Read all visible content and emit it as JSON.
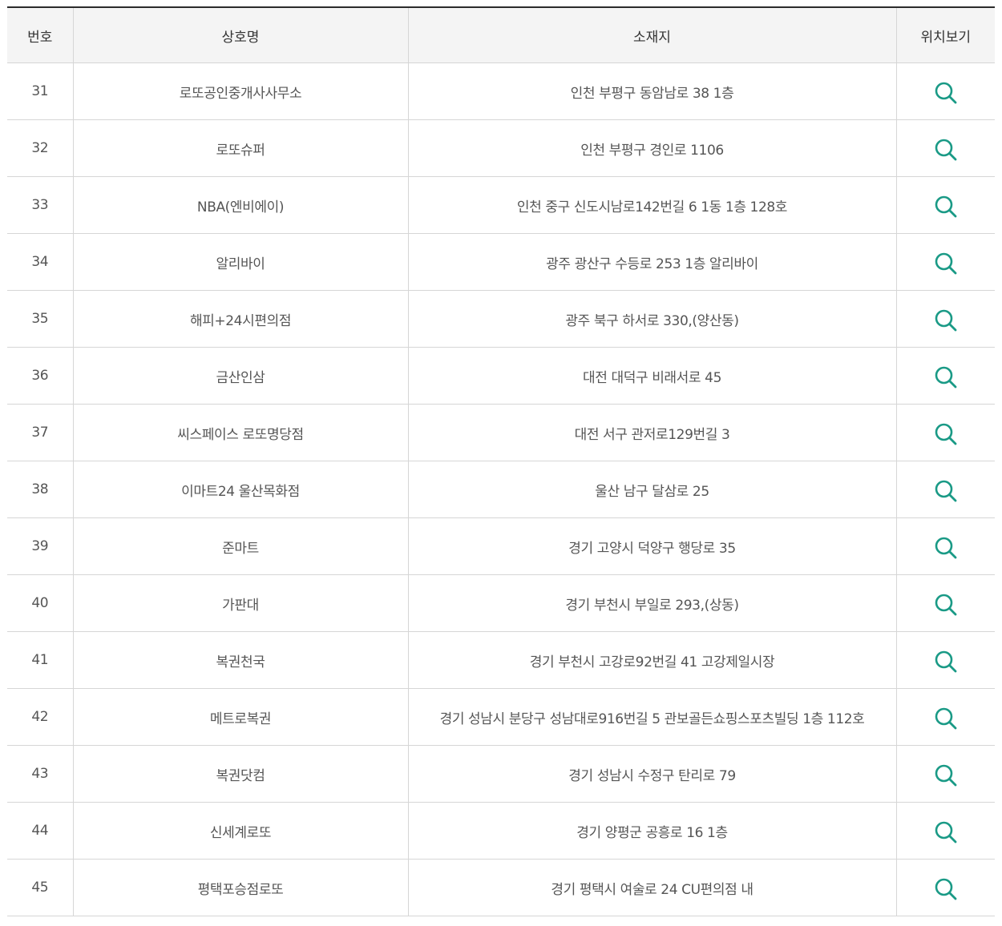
{
  "table": {
    "headers": {
      "no": "번호",
      "name": "상호명",
      "address": "소재지",
      "map": "위치보기"
    },
    "rows": [
      {
        "no": "31",
        "name": "로또공인중개사사무소",
        "address": "인천 부평구 동암남로 38 1층"
      },
      {
        "no": "32",
        "name": "로또슈퍼",
        "address": "인천 부평구 경인로 1106"
      },
      {
        "no": "33",
        "name": "NBA(엔비에이)",
        "address": "인천 중구 신도시남로142번길 6 1동 1층 128호"
      },
      {
        "no": "34",
        "name": "알리바이",
        "address": "광주 광산구 수등로 253 1층 알리바이"
      },
      {
        "no": "35",
        "name": "해피+24시편의점",
        "address": "광주 북구 하서로 330,(양산동)"
      },
      {
        "no": "36",
        "name": "금산인삼",
        "address": "대전 대덕구 비래서로 45"
      },
      {
        "no": "37",
        "name": "씨스페이스 로또명당점",
        "address": "대전 서구 관저로129번길 3"
      },
      {
        "no": "38",
        "name": "이마트24 울산목화점",
        "address": "울산 남구 달삼로 25"
      },
      {
        "no": "39",
        "name": "준마트",
        "address": "경기 고양시 덕양구 행당로 35"
      },
      {
        "no": "40",
        "name": "가판대",
        "address": "경기 부천시 부일로 293,(상동)"
      },
      {
        "no": "41",
        "name": "복권천국",
        "address": "경기 부천시 고강로92번길 41 고강제일시장"
      },
      {
        "no": "42",
        "name": "메트로복권",
        "address": "경기 성남시 분당구 성남대로916번길 5 관보골든쇼핑스포츠빌딩 1층 112호"
      },
      {
        "no": "43",
        "name": "복권닷컴",
        "address": "경기 성남시 수정구 탄리로 79"
      },
      {
        "no": "44",
        "name": "신세계로또",
        "address": "경기 양평군 공흥로 16 1층"
      },
      {
        "no": "45",
        "name": "평택포승점로또",
        "address": "경기 평택시 여술로 24 CU편의점 내"
      }
    ]
  },
  "icons": {
    "map_view": "search-icon",
    "map_view_color": "#1a9a86"
  }
}
